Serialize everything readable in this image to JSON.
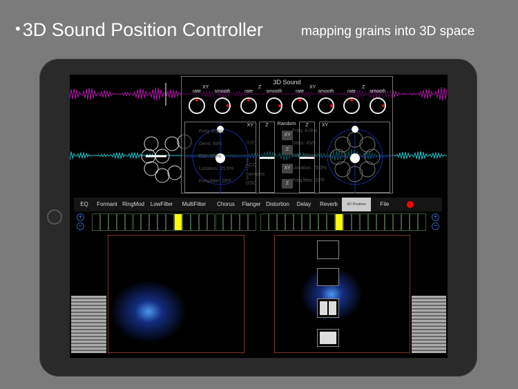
{
  "headline": {
    "bullet": "•",
    "title": "3D Sound Position Controller",
    "subtitle": "mapping grains into 3D space"
  },
  "sound_panel": {
    "title": "3D Sound",
    "knob_groups": [
      "XY",
      "Z",
      "XY",
      "Z"
    ],
    "knobs": [
      {
        "label": "rate",
        "value": 0.5
      },
      {
        "label": "smooth",
        "value": 0.8
      },
      {
        "label": "rate",
        "value": 0.5
      },
      {
        "label": "smooth",
        "value": 0.8
      },
      {
        "label": "rate",
        "value": 0.5
      },
      {
        "label": "smooth",
        "value": 0.8
      },
      {
        "label": "rate",
        "value": 0.5
      },
      {
        "label": "smooth",
        "value": 0.8
      }
    ],
    "left_xy_label": "XY",
    "z_label": "Z",
    "random_label": "Random",
    "right_xy_label": "XY",
    "random_buttons": [
      "XY",
      "Z",
      "XY",
      "Z"
    ],
    "left_info": [
      "Freq: 6.0Hz",
      "Dens: 69/s",
      "Dur: 20ms",
      "Location: 25.0%",
      "FreqJitter: OFF"
    ],
    "right_info": [
      "Freq: 6.0Hz",
      "Dens: 45/s",
      "Dur: 209ms",
      "Location: 75.0%",
      "FreqJitter: OFF"
    ],
    "info_box": {
      "title": "Info",
      "items": [
        "1 ACC",
        "2 Samples",
        "3 OSC"
      ]
    },
    "z_slider_left": 0.5,
    "z_slider_right": 0.5
  },
  "tabs": [
    {
      "label": "EQ"
    },
    {
      "label": "Formant"
    },
    {
      "label": "RingMod"
    },
    {
      "label": "LowFilter"
    },
    {
      "label": "MultiFilter"
    },
    {
      "label": "Chorus"
    },
    {
      "label": "Flanger"
    },
    {
      "label": "Distortion"
    },
    {
      "label": "Delay"
    },
    {
      "label": "Reverb"
    },
    {
      "label": "3D Position",
      "active": true
    },
    {
      "label": "File"
    }
  ],
  "sequencer": {
    "left_cells": 20,
    "left_active": 10,
    "right_cells": 20,
    "right_active": 9,
    "plus": "+",
    "minus": "−"
  },
  "colors": {
    "accent": "#ffff00",
    "record": "#ff0000",
    "wave_top": "#b01aa8",
    "wave_mid": "#1fc8d0",
    "glow": "#3a8cff"
  }
}
